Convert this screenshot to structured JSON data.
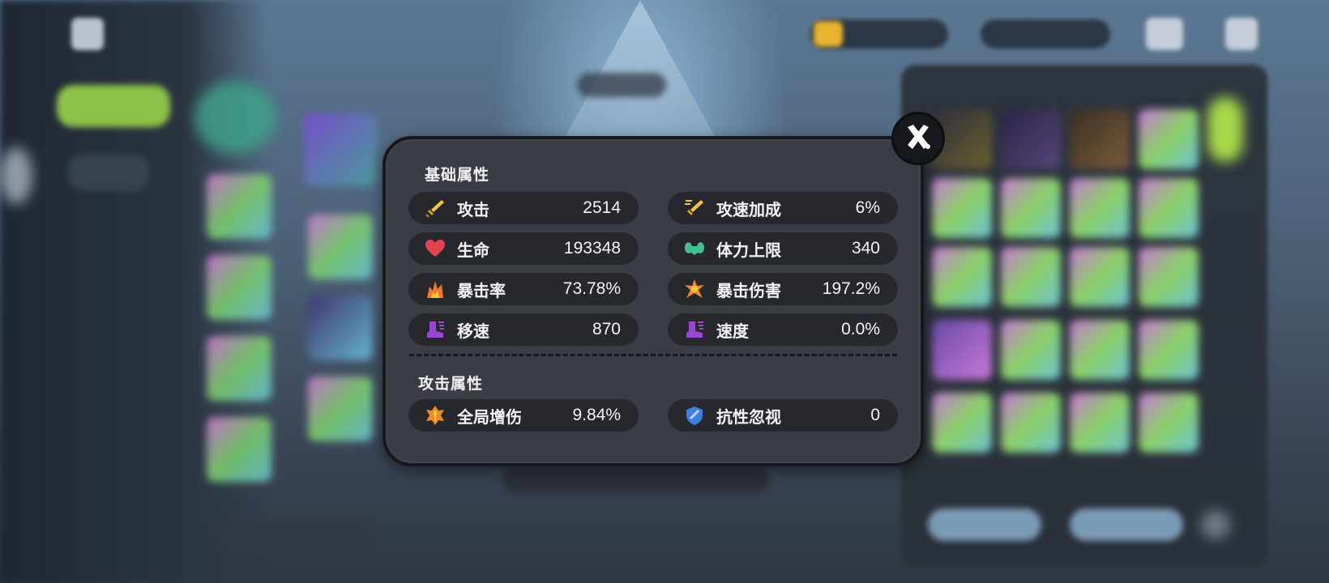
{
  "dialog": {
    "sections": [
      {
        "title": "基础属性",
        "stats": [
          {
            "label": "攻击",
            "value": "2514",
            "icon": "sword-icon"
          },
          {
            "label": "攻速加成",
            "value": "6%",
            "icon": "fast-sword-icon"
          },
          {
            "label": "生命",
            "value": "193348",
            "icon": "heart-icon"
          },
          {
            "label": "体力上限",
            "value": "340",
            "icon": "muscle-icon"
          },
          {
            "label": "暴击率",
            "value": "73.78%",
            "icon": "crit-burst-icon"
          },
          {
            "label": "暴击伤害",
            "value": "197.2%",
            "icon": "crit-damage-icon"
          },
          {
            "label": "移速",
            "value": "870",
            "icon": "boot-icon"
          },
          {
            "label": "速度",
            "value": "0.0%",
            "icon": "boot-speed-icon"
          }
        ]
      },
      {
        "title": "攻击属性",
        "stats": [
          {
            "label": "全局增伤",
            "value": "9.84%",
            "icon": "damage-boost-icon"
          },
          {
            "label": "抗性忽视",
            "value": "0",
            "icon": "shield-pierce-icon"
          }
        ]
      }
    ],
    "close_icon": "close-icon"
  },
  "colors": {
    "dialog_bg": "#3a3d44",
    "row_bg": "#26282d",
    "border": "#16181c",
    "text": "#f4f4f4"
  }
}
